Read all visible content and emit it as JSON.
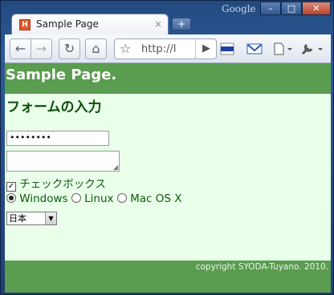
{
  "window": {
    "google_label": "Google",
    "buttons": {
      "minimize": "–",
      "maximize": "□",
      "close": "✕"
    }
  },
  "tab": {
    "favicon": "H",
    "title": "Sample Page",
    "close": "×",
    "new_tab": "+"
  },
  "toolbar": {
    "back": "←",
    "forward": "→",
    "reload": "↻",
    "home": "⌂",
    "star": "☆",
    "url": "http://l",
    "go": "▶"
  },
  "page": {
    "header": "Sample Page.",
    "section_title": "フォームの入力",
    "form": {
      "password_value": "••••••••",
      "textarea_value": "",
      "checkbox": {
        "label": "チェックボックス",
        "checked": true,
        "mark": "✓"
      },
      "radios": [
        {
          "label": "Windows",
          "checked": true
        },
        {
          "label": "Linux",
          "checked": false
        },
        {
          "label": "Mac OS X",
          "checked": false
        }
      ],
      "select": {
        "value": "日本",
        "arrow": "▼"
      }
    },
    "footer": "copyright SYODA-Tuyano. 2010."
  },
  "colors": {
    "header_bg": "#5a9c50",
    "page_bg": "#eaffea",
    "text_green": "#0d5a0d"
  }
}
